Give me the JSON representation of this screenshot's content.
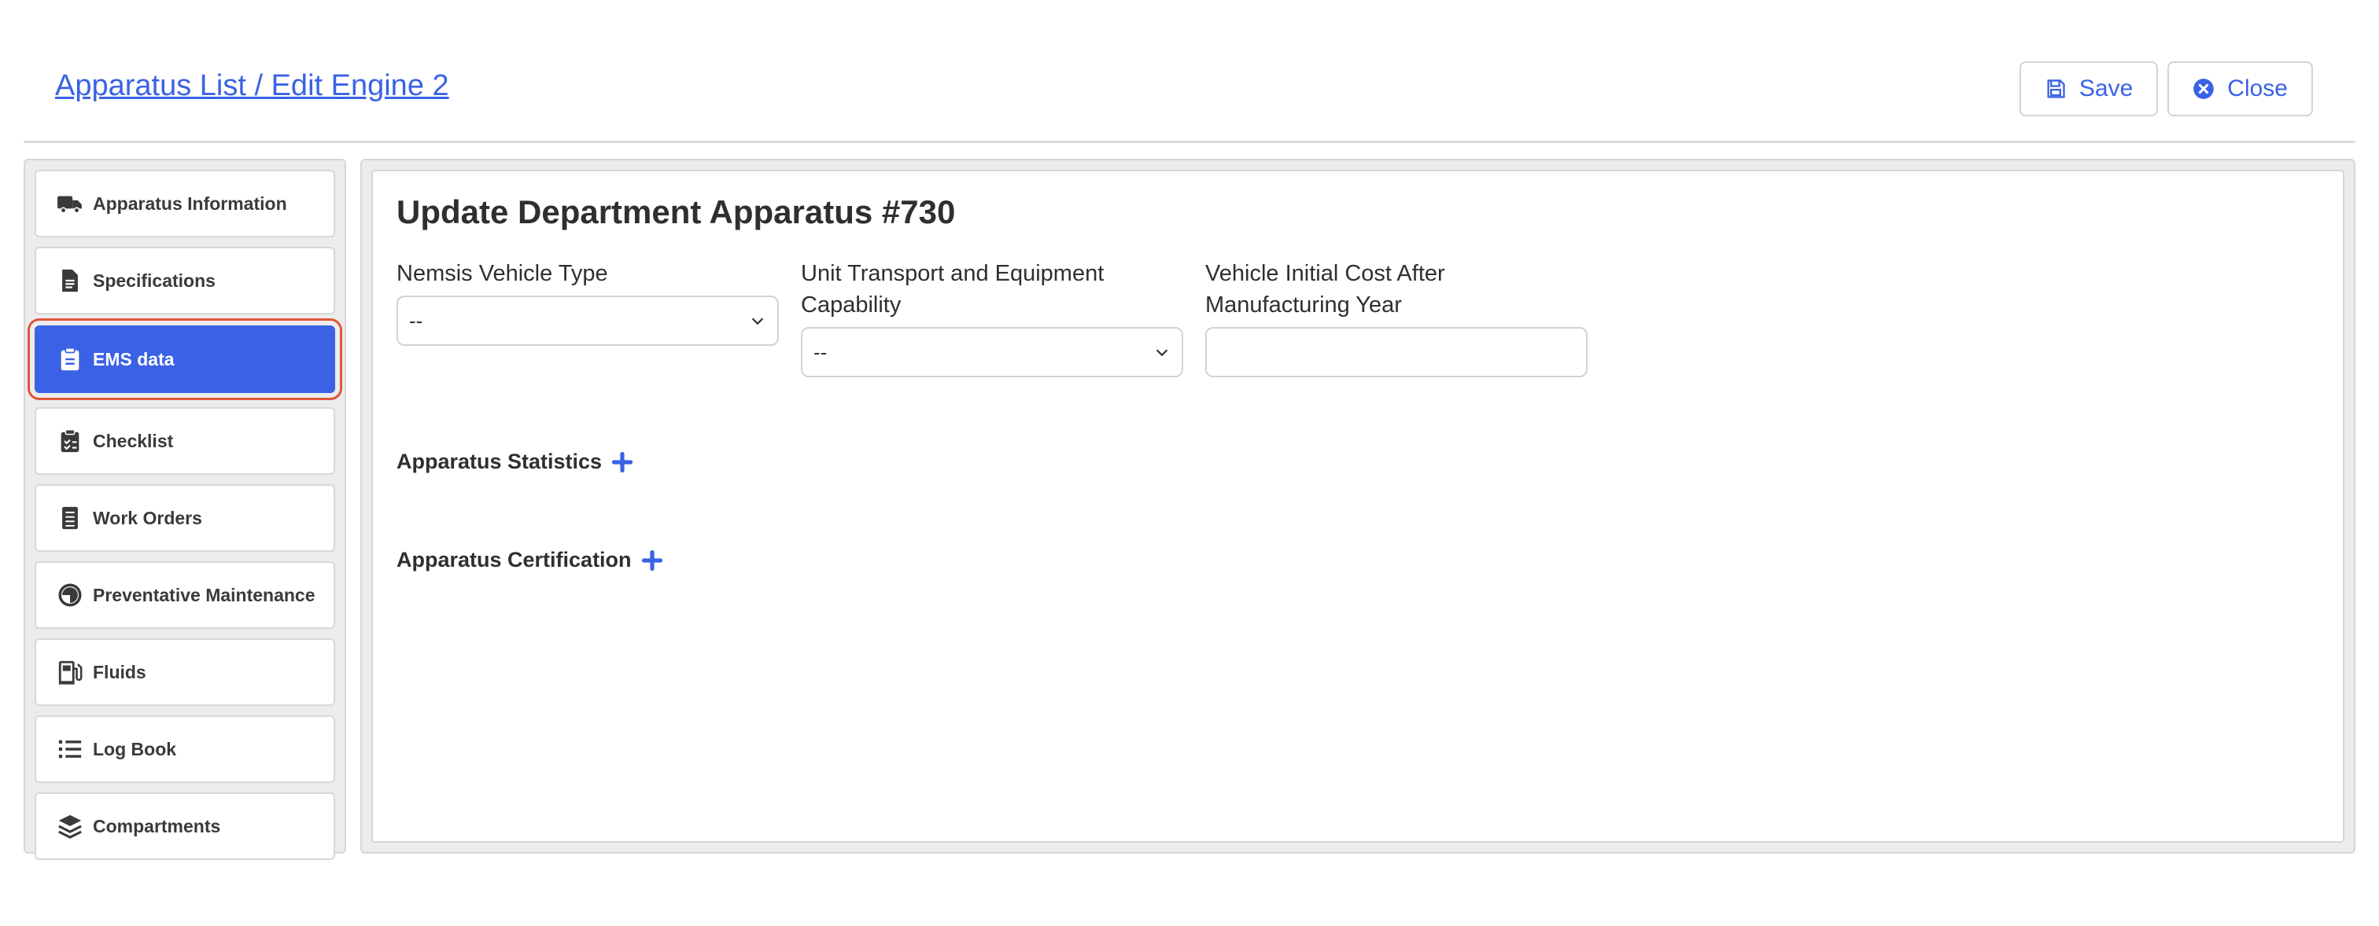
{
  "header": {
    "breadcrumb": "Apparatus List / Edit Engine 2",
    "save_label": "Save",
    "close_label": "Close"
  },
  "sidebar": {
    "items": [
      {
        "label": "Apparatus Information",
        "icon": "truck-icon"
      },
      {
        "label": "Specifications",
        "icon": "file-text-icon"
      },
      {
        "label": "EMS data",
        "icon": "clipboard-icon",
        "active": true
      },
      {
        "label": "Checklist",
        "icon": "clipboard-check-icon"
      },
      {
        "label": "Work Orders",
        "icon": "list-alt-icon"
      },
      {
        "label": "Preventative Maintenance",
        "icon": "half-circle-icon"
      },
      {
        "label": "Fluids",
        "icon": "gas-pump-icon"
      },
      {
        "label": "Log Book",
        "icon": "list-icon"
      },
      {
        "label": "Compartments",
        "icon": "layers-icon"
      }
    ]
  },
  "main": {
    "title": "Update Department Apparatus #730",
    "fields": {
      "nemsis_vehicle_type": {
        "label": "Nemsis Vehicle Type",
        "value": "--"
      },
      "unit_transport": {
        "label": "Unit Transport and Equipment Capability",
        "value": "--"
      },
      "initial_cost": {
        "label": "Vehicle Initial Cost After Manufacturing Year",
        "value": ""
      }
    },
    "sections": {
      "statistics": "Apparatus Statistics",
      "certification": "Apparatus Certification"
    }
  },
  "colors": {
    "accent": "#3b62e5",
    "highlight_outline": "#e0553a",
    "panel_bg": "#ececec"
  }
}
